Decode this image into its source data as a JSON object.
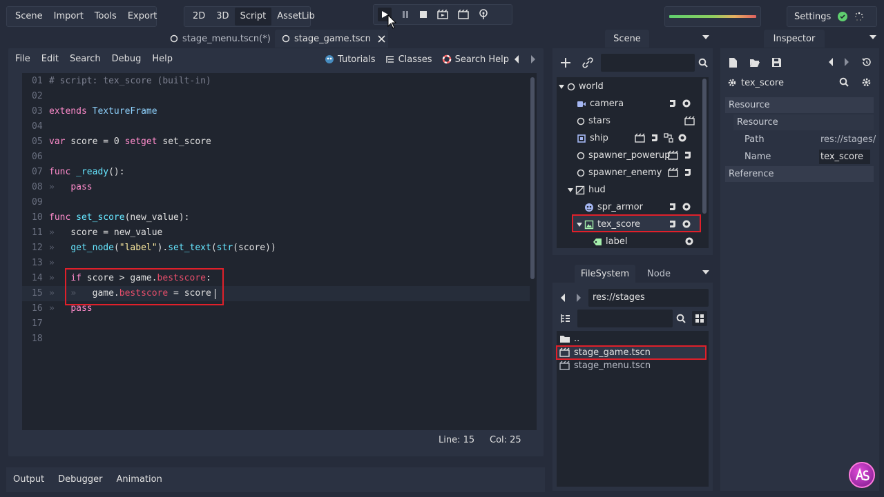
{
  "top_menu": [
    "Scene",
    "Import",
    "Tools",
    "Export"
  ],
  "modes": [
    {
      "label": "2D"
    },
    {
      "label": "3D"
    },
    {
      "label": "Script"
    },
    {
      "label": "AssetLib"
    }
  ],
  "active_mode": "Script",
  "settings_label": "Settings",
  "scene_tabs": [
    {
      "label": "stage_menu.tscn(*)"
    },
    {
      "label": "stage_game.tscn"
    }
  ],
  "script_menu": [
    "File",
    "Edit",
    "Search",
    "Debug",
    "Help"
  ],
  "script_links": {
    "tutorials": "Tutorials",
    "classes": "Classes",
    "search_help": "Search Help"
  },
  "code_lines": [
    {
      "n": "01",
      "text": "# script: tex_score (built-in)"
    },
    {
      "n": "02",
      "text": ""
    },
    {
      "n": "03",
      "text": "extends TextureFrame"
    },
    {
      "n": "04",
      "text": ""
    },
    {
      "n": "05",
      "text": "var score = 0 setget set_score"
    },
    {
      "n": "06",
      "text": ""
    },
    {
      "n": "07",
      "text": "func _ready():"
    },
    {
      "n": "08",
      "text": "»   pass"
    },
    {
      "n": "09",
      "text": ""
    },
    {
      "n": "10",
      "text": "func set_score(new_value):"
    },
    {
      "n": "11",
      "text": "»   score = new_value"
    },
    {
      "n": "12",
      "text": "»   get_node(\"label\").set_text(str(score))"
    },
    {
      "n": "13",
      "text": "»"
    },
    {
      "n": "14",
      "text": "»   if score > game.bestscore:"
    },
    {
      "n": "15",
      "text": "»   »   game.bestscore = score"
    },
    {
      "n": "16",
      "text": "»   pass"
    },
    {
      "n": "17",
      "text": ""
    },
    {
      "n": "18",
      "text": ""
    }
  ],
  "status": {
    "line": "Line: 15",
    "col": "Col: 25"
  },
  "bottom_tabs": [
    "Output",
    "Debugger",
    "Animation"
  ],
  "scene_dock": {
    "title": "Scene",
    "tree": [
      {
        "label": "world"
      },
      {
        "label": "camera"
      },
      {
        "label": "stars"
      },
      {
        "label": "ship"
      },
      {
        "label": "spawner_powerup"
      },
      {
        "label": "spawner_enemy"
      },
      {
        "label": "hud"
      },
      {
        "label": "spr_armor"
      },
      {
        "label": "tex_score"
      },
      {
        "label": "label"
      }
    ]
  },
  "filesystem": {
    "tab_fs": "FileSystem",
    "tab_node": "Node",
    "path": "res://stages",
    "files": [
      {
        "label": ".."
      },
      {
        "label": "stage_game.tscn"
      },
      {
        "label": "stage_menu.tscn"
      }
    ]
  },
  "inspector": {
    "title": "Inspector",
    "node": "tex_score",
    "section_resource": "Resource",
    "sub_resource": "Resource",
    "path_label": "Path",
    "path_value": "res://stages/",
    "name_label": "Name",
    "name_value": "tex_score",
    "section_reference": "Reference"
  },
  "colors": {
    "keyword": "#ff8ccc",
    "type": "#8fd3ff",
    "func": "#66e6ff",
    "string": "#ffeda1",
    "comment": "#7d8191",
    "member": "#e64e6b",
    "highlight": "#e0202a"
  }
}
